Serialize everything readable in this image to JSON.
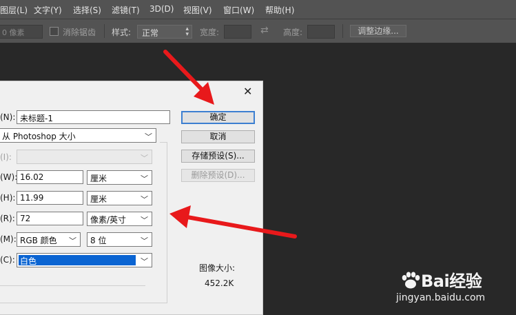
{
  "menubar": {
    "items": [
      "图层(L)",
      "文字(Y)",
      "选择(S)",
      "滤镜(T)",
      "3D(D)",
      "视图(V)",
      "窗口(W)",
      "帮助(H)"
    ]
  },
  "options": {
    "feather_value": "0 像素",
    "antialias_label": "消除锯齿",
    "style_label": "样式:",
    "style_value": "正常",
    "width_label": "宽度:",
    "swap_icon": "swap-arrows",
    "height_label": "高度:",
    "refine_edge_label": "调整边缘..."
  },
  "dialog": {
    "close_glyph": "✕",
    "name_label": "(N):",
    "name_value": "未标题-1",
    "preset_value": "从 Photoshop 大小",
    "size_label": "(I):",
    "width_label": "(W):",
    "width_value": "16.02",
    "width_unit": "厘米",
    "height_label": "(H):",
    "height_value": "11.99",
    "height_unit": "厘米",
    "resolution_label": "(R):",
    "resolution_value": "72",
    "resolution_unit": "像素/英寸",
    "mode_label": "(M):",
    "mode_value": "RGB 颜色",
    "bit_depth": "8 位",
    "bg_label": "(C):",
    "bg_value": "白色",
    "buttons": {
      "ok": "确定",
      "cancel": "取消",
      "save_preset": "存储预设(S)...",
      "delete_preset": "删除预设(D)..."
    },
    "image_size_label": "图像大小:",
    "image_size_value": "452.2K"
  },
  "watermark": {
    "logo_text": "Bai经验",
    "url": "jingyan.baidu.com"
  },
  "colors": {
    "arrow": "#e8191b",
    "selection": "#0a64d2",
    "accent": "#3c7fd1"
  }
}
